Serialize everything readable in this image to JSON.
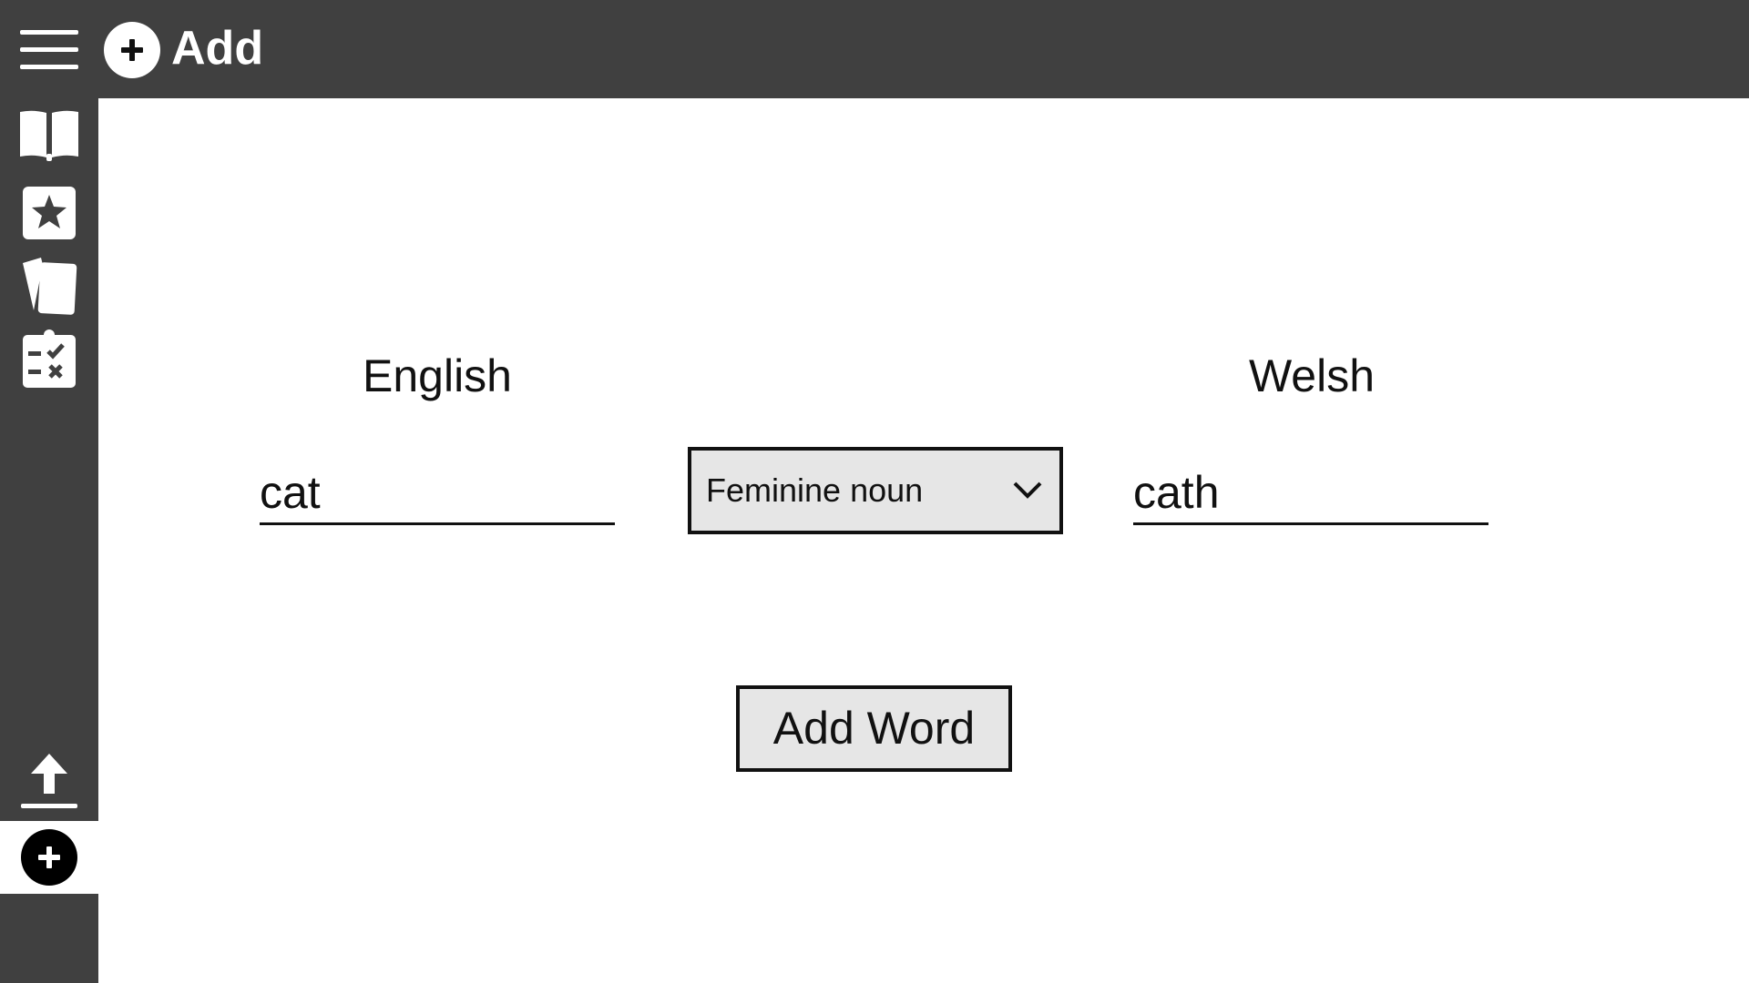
{
  "header": {
    "title": "Add",
    "menu_icon": "hamburger-menu-icon",
    "title_icon": "plus-circle-icon"
  },
  "sidebar": {
    "items": [
      {
        "name": "dictionary",
        "icon": "book-icon",
        "active": false
      },
      {
        "name": "favourites",
        "icon": "star-icon",
        "active": false
      },
      {
        "name": "flashcards",
        "icon": "cards-icon",
        "active": false
      },
      {
        "name": "quiz",
        "icon": "clipboard-check-icon",
        "active": false
      },
      {
        "name": "upload",
        "icon": "upload-icon",
        "active": false
      },
      {
        "name": "add",
        "icon": "plus-circle-icon",
        "active": true
      }
    ]
  },
  "form": {
    "english_label": "English",
    "welsh_label": "Welsh",
    "english_value": "cat",
    "welsh_value": "cath",
    "word_type_selected": "Feminine noun",
    "add_button_label": "Add Word"
  },
  "colors": {
    "chrome": "#404040",
    "background": "#ffffff",
    "control_fill": "#e6e6e6",
    "text": "#111111"
  }
}
